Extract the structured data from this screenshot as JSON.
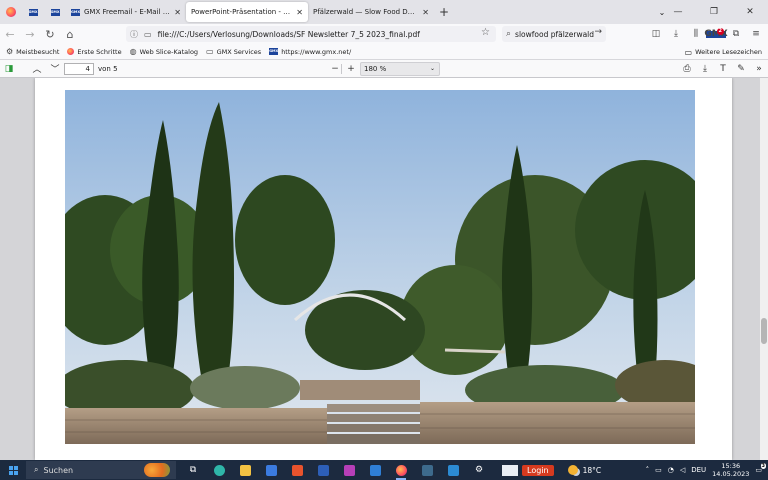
{
  "browser": {
    "tabs": [
      {
        "title": "",
        "pinned": true,
        "favicon": "gmx-icon"
      },
      {
        "title": "",
        "pinned": true,
        "favicon": "gmx-icon"
      },
      {
        "title": "GMX Freemail - E-Mail made in",
        "pinned": false,
        "favicon": "gmx-icon",
        "active": false
      },
      {
        "title": "PowerPoint-Präsentation - SF Newsl",
        "pinned": false,
        "favicon": "pdf-icon",
        "active": true
      },
      {
        "title": "Pfälzerwald — Slow Food Deutschla",
        "pinned": false,
        "favicon": "",
        "active": false
      }
    ],
    "url": "file:///C:/Users/Verlosung/Downloads/SF Newsletter 7_5 2023_final.pdf",
    "search_query": "slowfood pfälzerwald",
    "extension_badge": "2",
    "bookmarks": [
      {
        "label": "Meistbesucht",
        "icon": "gear-icon"
      },
      {
        "label": "Erste Schritte",
        "icon": "firefox-icon"
      },
      {
        "label": "Web Slice-Katalog",
        "icon": "globe-icon"
      },
      {
        "label": "GMX Services",
        "icon": "folder-icon"
      },
      {
        "label": "https://www.gmx.net/",
        "icon": "gmx-icon"
      }
    ],
    "other_bookmarks": "Weitere Lesezeichen"
  },
  "pdf": {
    "page_number": "4",
    "page_of": "von 5",
    "zoom": "180 %"
  },
  "taskbar": {
    "search_label": "Suchen",
    "login_label": "Login",
    "temperature": "18°C",
    "language": "DEU",
    "time": "15:36",
    "date": "14.05.2023",
    "notification_count": "3"
  },
  "colors": {
    "accent_taskbar": "#1c2a3f",
    "login_red": "#d63a1f",
    "gmx_blue": "#1c449b"
  }
}
